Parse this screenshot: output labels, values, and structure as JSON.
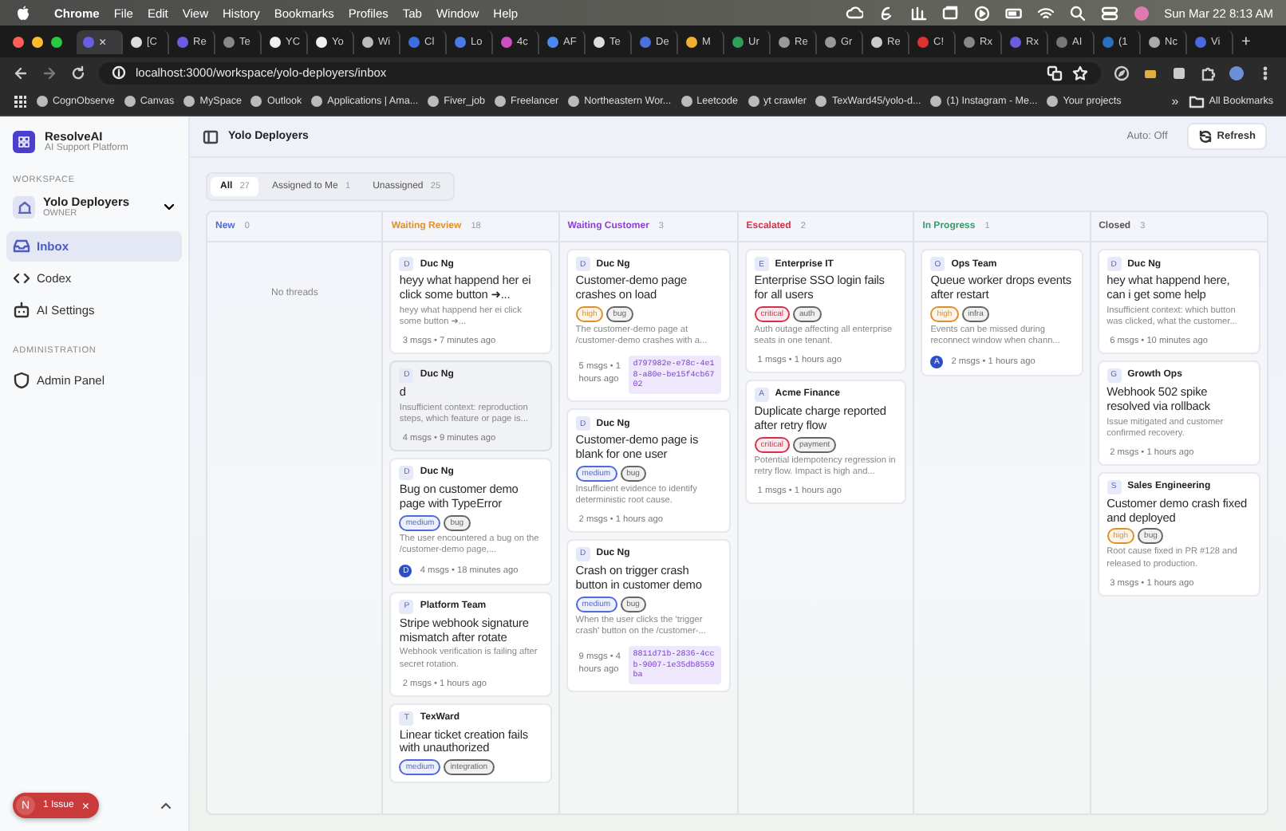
{
  "menu_bar": {
    "app": "Chrome",
    "items": [
      "File",
      "Edit",
      "View",
      "History",
      "Bookmarks",
      "Profiles",
      "Tab",
      "Window",
      "Help"
    ],
    "clock": "Sun Mar 22  8:13 AM"
  },
  "browser": {
    "tabs": [
      {
        "close": "×",
        "selected": true,
        "color": "#6a5de0"
      },
      {
        "label": "[C",
        "selected": false,
        "color": "#dddddd"
      },
      {
        "label": "Re",
        "selected": false,
        "color": "#6a5de0"
      },
      {
        "label": "Te",
        "selected": false,
        "color": "#888888"
      },
      {
        "label": "YC",
        "selected": false,
        "color": "#f0f0f0"
      },
      {
        "label": "Yo",
        "selected": false,
        "color": "#f0f0f0"
      },
      {
        "label": "Wi",
        "selected": false,
        "color": "#bbbbbb"
      },
      {
        "label": "Cl",
        "selected": false,
        "color": "#3b6fe0"
      },
      {
        "label": "Lo",
        "selected": false,
        "color": "#4a7ae8"
      },
      {
        "label": "4c",
        "selected": false,
        "color": "#d04fc0"
      },
      {
        "label": "AF",
        "selected": false,
        "color": "#4a8af0"
      },
      {
        "label": "Te",
        "selected": false,
        "color": "#dddddd"
      },
      {
        "label": "De",
        "selected": false,
        "color": "#4a70e0"
      },
      {
        "label": "M",
        "selected": false,
        "color": "#f0b030"
      },
      {
        "label": "Ur",
        "selected": false,
        "color": "#2ea05a"
      },
      {
        "label": "Re",
        "selected": false,
        "color": "#999999"
      },
      {
        "label": "Gr",
        "selected": false,
        "color": "#999999"
      },
      {
        "label": "Re",
        "selected": false,
        "color": "#cccccc"
      },
      {
        "label": "C!",
        "selected": false,
        "color": "#e03030"
      },
      {
        "label": "Rx",
        "selected": false,
        "color": "#888888"
      },
      {
        "label": "Rx",
        "selected": false,
        "color": "#6a5de0"
      },
      {
        "label": "AI",
        "selected": false,
        "color": "#777777"
      },
      {
        "label": "(1",
        "selected": false,
        "color": "#2a6fc0"
      },
      {
        "label": "Nc",
        "selected": false,
        "color": "#aaaaaa"
      },
      {
        "label": "Vi",
        "selected": false,
        "color": "#4a6ae0"
      }
    ],
    "new_tab": "+",
    "url": "localhost:3000/workspace/yolo-deployers/inbox",
    "bookmarks": [
      "CognObserve",
      "Canvas",
      "MySpace",
      "Outlook",
      "Applications | Ama...",
      "Fiver_job",
      "Freelancer",
      "Northeastern Wor...",
      "Leetcode",
      "yt crawler",
      "TexWard45/yolo-d...",
      "(1) Instagram - Me...",
      "Your projects"
    ],
    "more_bookmarks": "»",
    "all_bookmarks": "All Bookmarks"
  },
  "sidebar": {
    "brand": "ResolveAI",
    "tagline": "AI Support Platform",
    "workspace_heading": "WORKSPACE",
    "workspace": {
      "name": "Yolo Deployers",
      "role": "OWNER"
    },
    "items": [
      {
        "label": "Inbox",
        "selected": true
      },
      {
        "label": "Codex",
        "selected": false
      },
      {
        "label": "AI Settings",
        "selected": false
      }
    ],
    "admin_heading": "ADMINISTRATION",
    "admin_items": [
      {
        "label": "Admin Panel",
        "selected": false
      }
    ],
    "issue_badge": {
      "initial": "N",
      "label": "1 Issue",
      "close": "×"
    }
  },
  "header": {
    "title": "Yolo Deployers",
    "auto": "Auto: Off",
    "refresh": "Refresh"
  },
  "filters": [
    {
      "label": "All",
      "count": "27",
      "selected": true
    },
    {
      "label": "Assigned to Me",
      "count": "1",
      "selected": false
    },
    {
      "label": "Unassigned",
      "count": "25",
      "selected": false
    }
  ],
  "columns": [
    {
      "title": "New",
      "count": "0",
      "color": "#4f6bd8",
      "empty": "No threads"
    },
    {
      "title": "Waiting Review",
      "count": "18",
      "color": "#e0902a",
      "cards": [
        {
          "initial": "D",
          "author": "Duc Ng",
          "title": "heyy what happend her ei click some button ➜...",
          "selected": false,
          "summary": "heyy what happend her ei click some button ➜...",
          "meta": "3 msgs • 7 minutes ago"
        },
        {
          "initial": "D",
          "author": "Duc Ng",
          "title": "d",
          "selected": true,
          "summary": "Insufficient context: reproduction steps, which feature or page is...",
          "meta": "4 msgs • 9 minutes ago"
        },
        {
          "initial": "D",
          "author": "Duc Ng",
          "title": "Bug on customer demo page with TypeError",
          "selected": false,
          "tags": [
            {
              "label": "medium",
              "color": "#4f6bd8"
            },
            {
              "label": "bug",
              "color": "#666666"
            }
          ],
          "summary": "The user encountered a bug on the /customer-demo page,...",
          "assignee": "D",
          "meta": "4 msgs • 18 minutes ago"
        },
        {
          "initial": "P",
          "author": "Platform Team",
          "title": "Stripe webhook signature mismatch after rotate",
          "selected": false,
          "summary": "Webhook verification is failing after secret rotation.",
          "meta": "2 msgs • 1 hours ago"
        },
        {
          "initial": "T",
          "author": "TexWard",
          "title": "Linear ticket creation fails with unauthorized",
          "selected": false,
          "tags": [
            {
              "label": "medium",
              "color": "#4f6bd8"
            },
            {
              "label": "integration",
              "color": "#666666"
            }
          ]
        }
      ]
    },
    {
      "title": "Waiting Customer",
      "count": "3",
      "color": "#8b3fd9",
      "cards": [
        {
          "initial": "D",
          "author": "Duc Ng",
          "title": "Customer-demo page crashes on load",
          "selected": false,
          "tags": [
            {
              "label": "high",
              "color": "#e0902a"
            },
            {
              "label": "bug",
              "color": "#666666"
            }
          ],
          "summary": "The customer-demo page at /customer-demo crashes with a...",
          "meta": "5 msgs • 1 hours ago",
          "ticket": "d797982e-e78c-4e18-a80e-be15f4cb6702"
        },
        {
          "initial": "D",
          "author": "Duc Ng",
          "title": "Customer-demo page is blank for one user",
          "selected": false,
          "tags": [
            {
              "label": "medium",
              "color": "#4f6bd8"
            },
            {
              "label": "bug",
              "color": "#666666"
            }
          ],
          "summary": "Insufficient evidence to identify deterministic root cause.",
          "meta": "2 msgs • 1 hours ago"
        },
        {
          "initial": "D",
          "author": "Duc Ng",
          "title": "Crash on trigger crash button in customer demo",
          "selected": false,
          "tags": [
            {
              "label": "medium",
              "color": "#4f6bd8"
            },
            {
              "label": "bug",
              "color": "#666666"
            }
          ],
          "summary": "When the user clicks the 'trigger crash' button on the /customer-...",
          "meta": "9 msgs • 4 hours ago",
          "ticket": "8811d71b-2836-4ccb-9007-1e35db8559ba"
        }
      ]
    },
    {
      "title": "Escalated",
      "count": "2",
      "color": "#d6304a",
      "cards": [
        {
          "initial": "E",
          "author": "Enterprise IT",
          "title": "Enterprise SSO login fails for all users",
          "selected": false,
          "tags": [
            {
              "label": "critical",
              "color": "#d6304a"
            },
            {
              "label": "auth",
              "color": "#666666"
            }
          ],
          "summary": "Auth outage affecting all enterprise seats in one tenant.",
          "meta": "1 msgs • 1 hours ago"
        },
        {
          "initial": "A",
          "author": "Acme Finance",
          "title": "Duplicate charge reported after retry flow",
          "selected": false,
          "tags": [
            {
              "label": "critical",
              "color": "#d6304a"
            },
            {
              "label": "payment",
              "color": "#666666"
            }
          ],
          "summary": "Potential idempotency regression in retry flow. Impact is high and...",
          "meta": "1 msgs • 1 hours ago"
        }
      ]
    },
    {
      "title": "In Progress",
      "count": "1",
      "color": "#3a9a6a",
      "cards": [
        {
          "initial": "O",
          "author": "Ops Team",
          "title": "Queue worker drops events after restart",
          "selected": false,
          "tags": [
            {
              "label": "high",
              "color": "#e0902a"
            },
            {
              "label": "infra",
              "color": "#666666"
            }
          ],
          "summary": "Events can be missed during reconnect window when chann...",
          "assignee": "A",
          "meta": "2 msgs • 1 hours ago"
        }
      ]
    },
    {
      "title": "Closed",
      "count": "3",
      "color": "#555555",
      "cards": [
        {
          "initial": "D",
          "author": "Duc Ng",
          "title": "hey what happend here, can i get some help",
          "selected": false,
          "summary": "Insufficient context: which button was clicked, what the customer...",
          "meta": "6 msgs • 10 minutes ago"
        },
        {
          "initial": "G",
          "author": "Growth Ops",
          "title": "Webhook 502 spike resolved via rollback",
          "selected": false,
          "summary": "Issue mitigated and customer confirmed recovery.",
          "meta": "2 msgs • 1 hours ago"
        },
        {
          "initial": "S",
          "author": "Sales Engineering",
          "title": "Customer demo crash fixed and deployed",
          "selected": false,
          "tags": [
            {
              "label": "high",
              "color": "#e0902a"
            },
            {
              "label": "bug",
              "color": "#666666"
            }
          ],
          "summary": "Root cause fixed in PR #128 and released to production.",
          "meta": "3 msgs • 1 hours ago"
        }
      ]
    }
  ]
}
